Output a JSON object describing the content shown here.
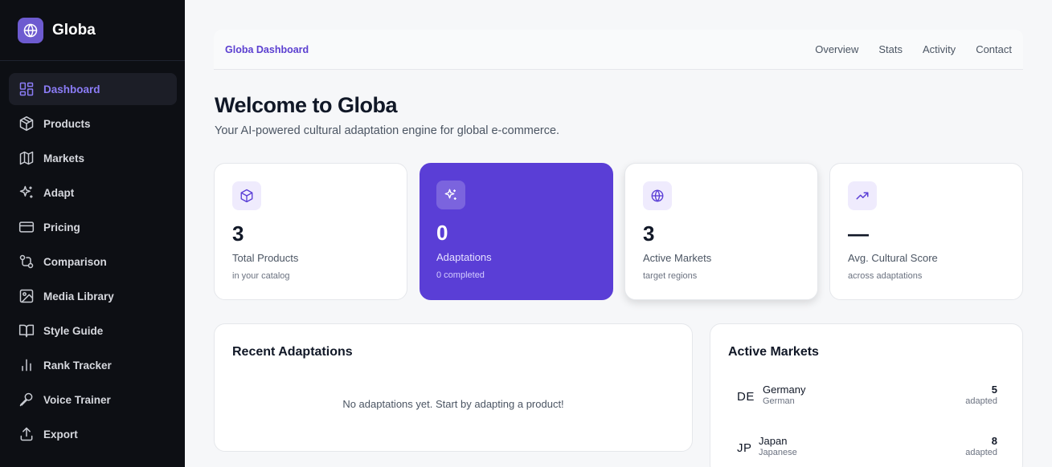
{
  "brand": {
    "name": "Globa"
  },
  "sidebar": {
    "items": [
      {
        "label": "Dashboard",
        "icon": "dashboard-grid-icon",
        "active": true
      },
      {
        "label": "Products",
        "icon": "box-icon"
      },
      {
        "label": "Markets",
        "icon": "map-icon"
      },
      {
        "label": "Adapt",
        "icon": "sparkles-icon"
      },
      {
        "label": "Pricing",
        "icon": "credit-card-icon"
      },
      {
        "label": "Comparison",
        "icon": "git-compare-icon"
      },
      {
        "label": "Media Library",
        "icon": "image-icon"
      },
      {
        "label": "Style Guide",
        "icon": "book-open-icon"
      },
      {
        "label": "Rank Tracker",
        "icon": "bar-chart-icon"
      },
      {
        "label": "Voice Trainer",
        "icon": "microphone-icon"
      },
      {
        "label": "Export",
        "icon": "upload-icon"
      }
    ]
  },
  "topbar": {
    "title": "Globa Dashboard",
    "links": [
      "Overview",
      "Stats",
      "Activity",
      "Contact"
    ]
  },
  "header": {
    "title": "Welcome to Globa",
    "subtitle": "Your AI-powered cultural adaptation engine for global e-commerce."
  },
  "stats": [
    {
      "value": "3",
      "label": "Total Products",
      "sub": "in your catalog",
      "icon": "box-icon"
    },
    {
      "value": "0",
      "label": "Adaptations",
      "sub": "0 completed",
      "icon": "sparkles-icon"
    },
    {
      "value": "3",
      "label": "Active Markets",
      "sub": "target regions",
      "icon": "globe-icon"
    },
    {
      "value": "—",
      "label": "Avg. Cultural Score",
      "sub": "across adaptations",
      "icon": "trending-up-icon"
    }
  ],
  "recent": {
    "title": "Recent Adaptations",
    "empty": "No adaptations yet. Start by adapting a product!"
  },
  "markets": {
    "title": "Active Markets",
    "unit": "adapted",
    "items": [
      {
        "code": "DE",
        "name": "Germany",
        "language": "German",
        "count": "5"
      },
      {
        "code": "JP",
        "name": "Japan",
        "language": "Japanese",
        "count": "8"
      }
    ]
  },
  "colors": {
    "accent": "#5a3ed6",
    "sidebar_bg": "#0d0f14",
    "active_text": "#8b7cf6"
  }
}
